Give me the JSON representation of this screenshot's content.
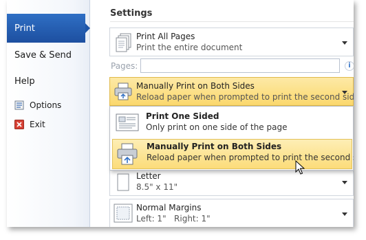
{
  "sidebar": {
    "items": [
      {
        "label": "Print"
      },
      {
        "label": "Save & Send"
      },
      {
        "label": "Help"
      },
      {
        "label": "Options",
        "icon": "options-icon"
      },
      {
        "label": "Exit",
        "icon": "exit-icon"
      }
    ]
  },
  "settings": {
    "title": "Settings",
    "print_range": {
      "title": "Print All Pages",
      "subtitle": "Print the entire document"
    },
    "pages": {
      "label": "Pages:",
      "value": ""
    },
    "duplex": {
      "title": "Manually Print on Both Sides",
      "subtitle": "Reload paper when prompted to print the second side"
    },
    "menu": [
      {
        "title": "Print One Sided",
        "subtitle": "Only print on one side of the page"
      },
      {
        "title": "Manually Print on Both Sides",
        "subtitle": "Reload paper when prompted to print the second side"
      }
    ],
    "paper": {
      "title": "Letter",
      "subtitle": "8.5\" x 11\""
    },
    "margins": {
      "title": "Normal Margins",
      "subtitle": "Left: 1\"   Right: 1\""
    }
  },
  "colors": {
    "accent": "#1e55a8",
    "highlight": "#fcdc7a"
  }
}
